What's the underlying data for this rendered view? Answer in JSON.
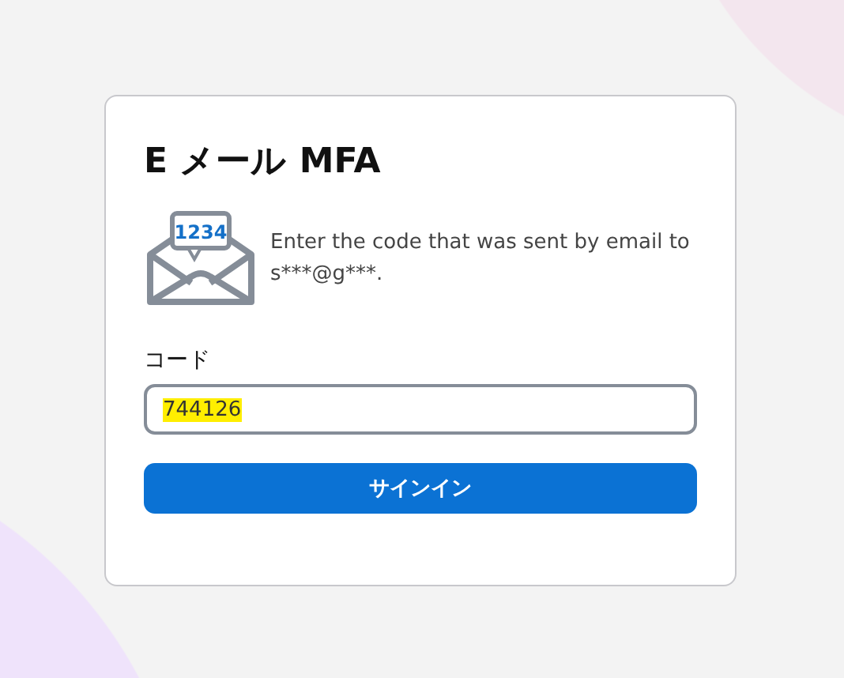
{
  "title": "E メール MFA",
  "message": {
    "icon_text": "1234",
    "text": "Enter the code that was sent by email to s***@g***."
  },
  "code_field": {
    "label": "コード",
    "value": "744126",
    "highlighted": true
  },
  "submit_button": "サインイン"
}
